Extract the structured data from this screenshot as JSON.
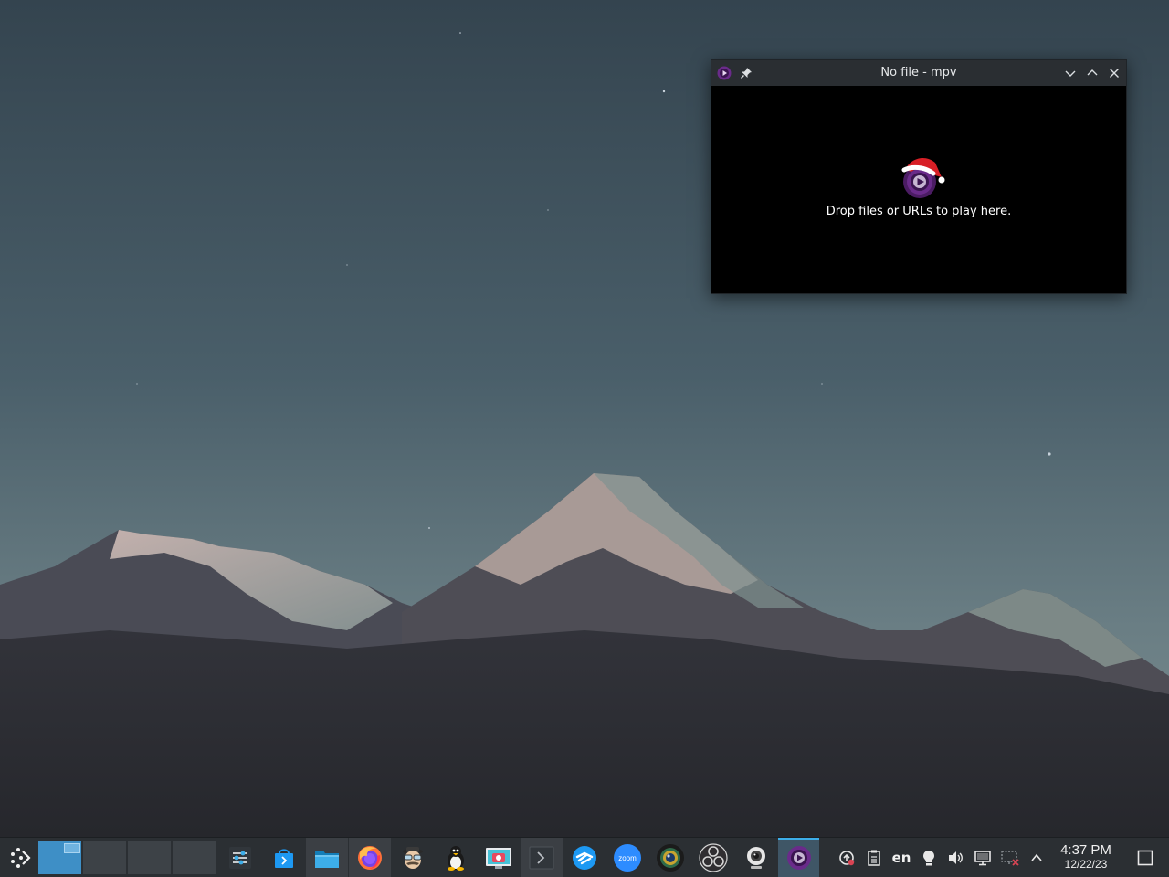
{
  "mpv_window": {
    "title": "No file - mpv",
    "drop_text": "Drop files or URLs to play here.",
    "icon": "mpv-icon",
    "buttons": [
      "pin-icon",
      "minimize-icon",
      "maximize-icon",
      "close-icon"
    ]
  },
  "taskbar": {
    "launcher_icon": "kde-launcher-icon",
    "virtual_desktops": 4,
    "active_desktop": 1,
    "tasks": [
      "system-settings-icon",
      "discover-store-icon",
      "dolphin-file-manager-icon",
      "firefox-icon",
      "spy-agent-icon",
      "tux-linux-icon",
      "screenshot-app-icon",
      "terminal-icon",
      "kdeconnect-icon",
      "zoom-icon",
      "camera-lens-icon",
      "obs-studio-icon",
      "webcam-icon",
      "mpv-icon"
    ],
    "zoom_label": "zoom",
    "tray": {
      "keyboard_layout": "en",
      "icons": [
        "update-icon",
        "clipboard-icon",
        "night-light-icon",
        "volume-icon",
        "display-icon",
        "network-disconnected-icon",
        "tray-expand-icon"
      ]
    },
    "clock": {
      "time": "4:37 PM",
      "date": "12/22/23"
    },
    "show_desktop_icon": "show-desktop-icon"
  },
  "colors": {
    "accent": "#3daee9",
    "mpv_purple": "#6a2b8a",
    "taskbar_bg": "#2b2f33",
    "titlebar_bg": "#2a2e32"
  }
}
